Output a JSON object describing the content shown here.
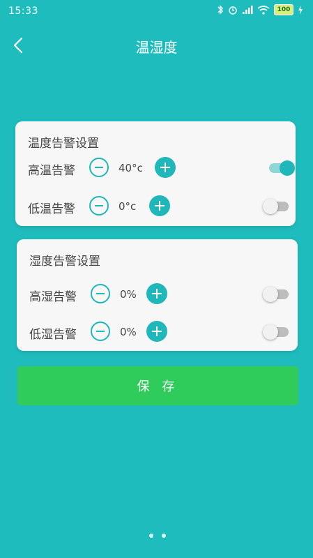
{
  "status_bar": {
    "time": "15:33",
    "battery": "100"
  },
  "header": {
    "title": "温湿度"
  },
  "temperature": {
    "section_title": "温度告警设置",
    "high": {
      "label": "高温告警",
      "value": "40°c",
      "enabled": true
    },
    "low": {
      "label": "低温告警",
      "value": "0°c",
      "enabled": false
    }
  },
  "humidity": {
    "section_title": "湿度告警设置",
    "high": {
      "label": "高湿告警",
      "value": "0%",
      "enabled": false
    },
    "low": {
      "label": "低湿告警",
      "value": "0%",
      "enabled": false
    }
  },
  "actions": {
    "save_label": "保 存"
  },
  "page_indicator": {
    "count": 2,
    "active": 0
  },
  "colors": {
    "background": "#1fbcbd",
    "accent": "#1fb7b9",
    "save": "#2fcb5b"
  }
}
